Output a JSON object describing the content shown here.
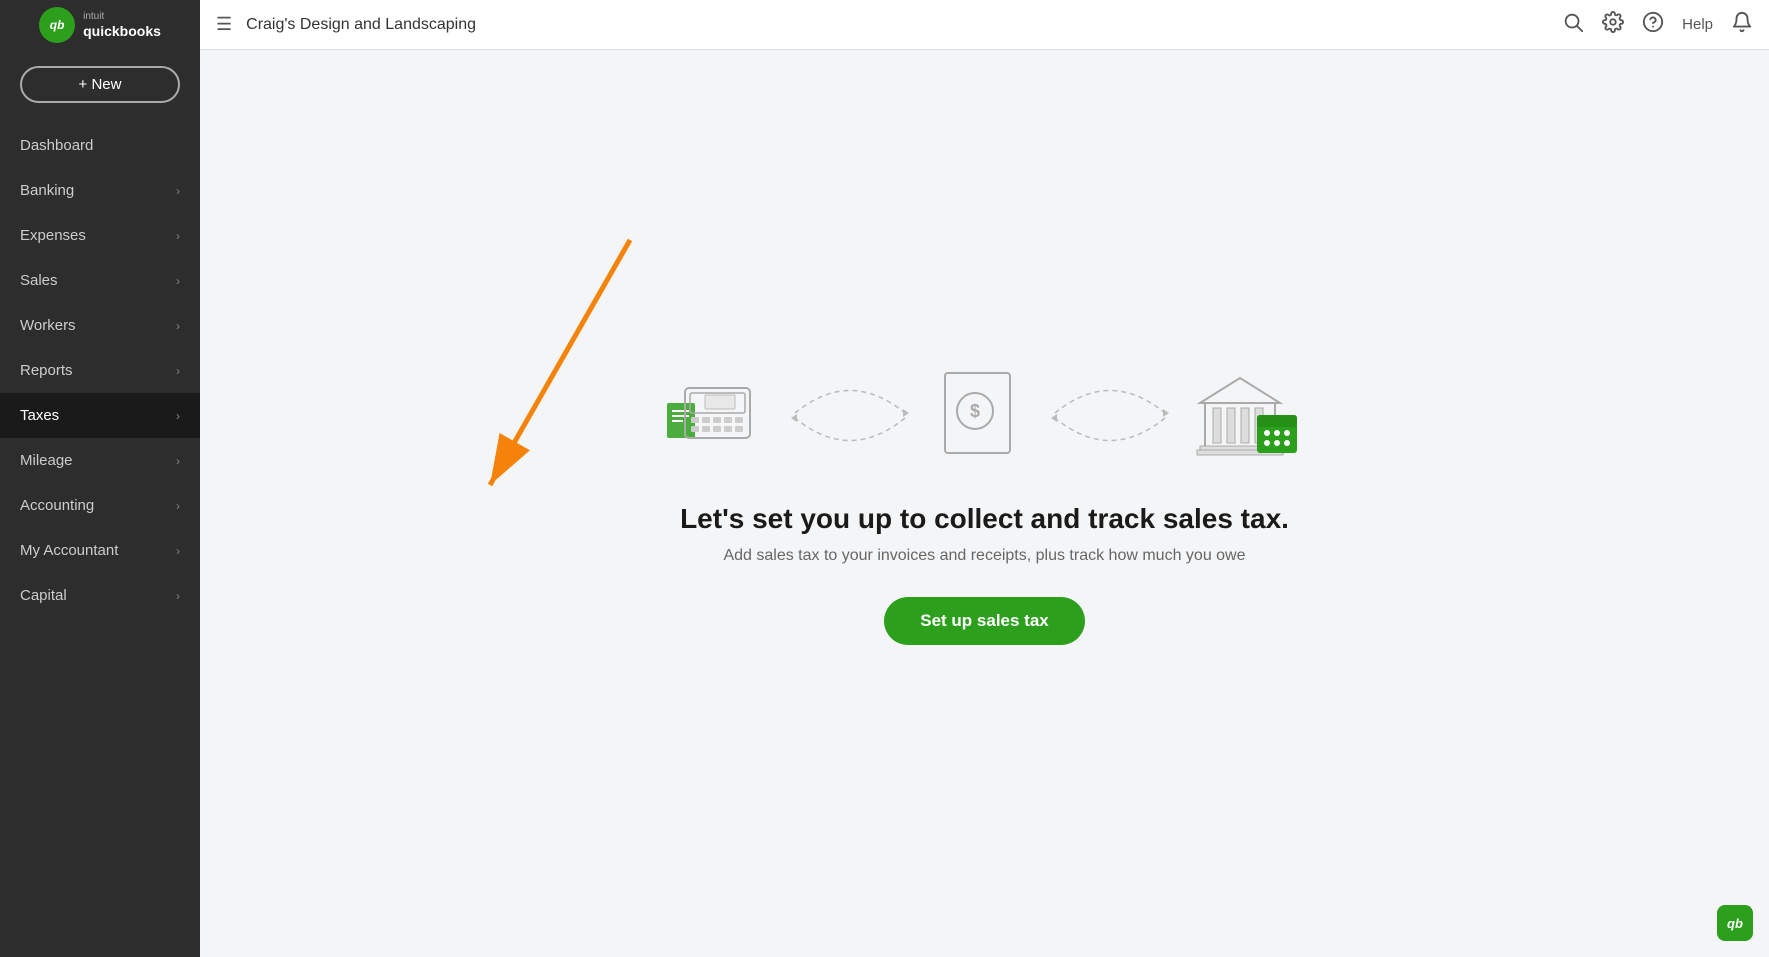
{
  "header": {
    "hamburger": "☰",
    "company_name": "Craig's Design and Landscaping",
    "search_label": "search",
    "settings_label": "settings",
    "help_label": "Help",
    "notification_label": "notifications"
  },
  "logo": {
    "text": "intuit",
    "subtext": "quickbooks",
    "initials": "qb"
  },
  "sidebar": {
    "new_button_label": "+ New",
    "items": [
      {
        "label": "Dashboard",
        "has_chevron": false,
        "active": false
      },
      {
        "label": "Banking",
        "has_chevron": true,
        "active": false
      },
      {
        "label": "Expenses",
        "has_chevron": true,
        "active": false
      },
      {
        "label": "Sales",
        "has_chevron": true,
        "active": false
      },
      {
        "label": "Workers",
        "has_chevron": true,
        "active": false
      },
      {
        "label": "Reports",
        "has_chevron": true,
        "active": false
      },
      {
        "label": "Taxes",
        "has_chevron": true,
        "active": true
      },
      {
        "label": "Mileage",
        "has_chevron": true,
        "active": false
      },
      {
        "label": "Accounting",
        "has_chevron": true,
        "active": false
      },
      {
        "label": "My Accountant",
        "has_chevron": true,
        "active": false
      },
      {
        "label": "Capital",
        "has_chevron": true,
        "active": false
      }
    ]
  },
  "main": {
    "heading": "Let's set you up to collect and track sales tax.",
    "subtext": "Add sales tax to your invoices and receipts, plus track how much you owe",
    "cta_button": "Set up sales tax"
  },
  "colors": {
    "sidebar_bg": "#2d2d2d",
    "active_item_bg": "#1a1a1a",
    "content_bg": "#f4f5f7",
    "green": "#2ca01c",
    "orange_arrow": "#f5830a"
  }
}
